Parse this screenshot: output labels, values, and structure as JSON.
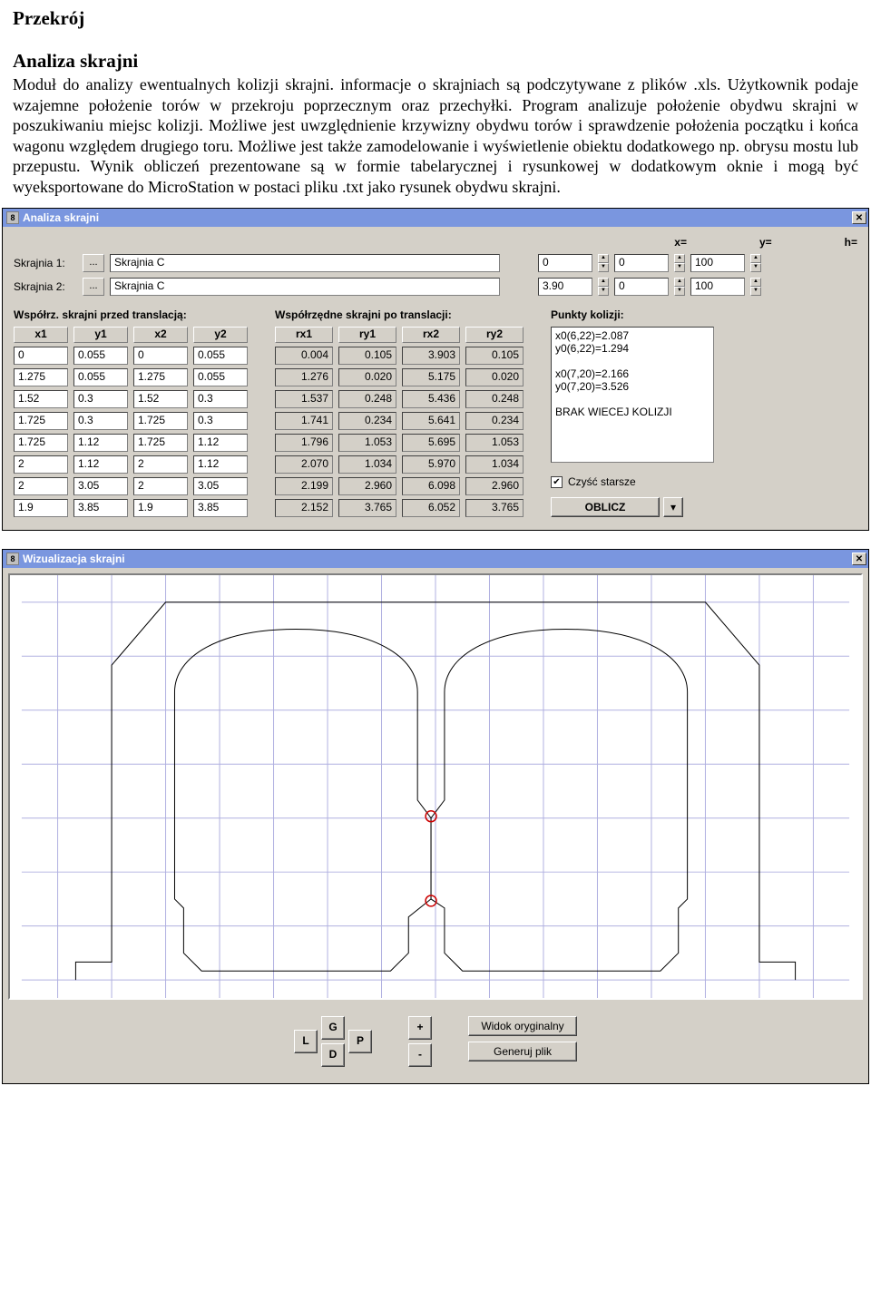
{
  "doc": {
    "heading": "Przekrój",
    "subheading": "Analiza skrajni",
    "paragraph": "Moduł do analizy ewentualnych kolizji skrajni. informacje o skrajniach są podczytywane z plików .xls. Użytkownik podaje wzajemne położenie torów w przekroju poprzecznym oraz przechyłki. Program analizuje położenie obydwu skrajni w poszukiwaniu miejsc kolizji. Możliwe jest uwzględnienie krzywizny obydwu torów i sprawdzenie położenia początku i końca wagonu względem drugiego toru. Możliwe jest także zamodelowanie i wyświetlenie obiektu dodatkowego np. obrysu mostu lub przepustu. Wynik obliczeń prezentowane są w formie tabelarycznej i rysunkowej w dodatkowym oknie i mogą być wyeksportowane do MicroStation w postaci pliku .txt jako rysunek obydwu skrajni."
  },
  "dlg1": {
    "title": "Analiza skrajni",
    "labels": {
      "skrajnia1": "Skrajnia 1:",
      "skrajnia2": "Skrajnia 2:",
      "browse": "...",
      "x": "x=",
      "y": "y=",
      "h": "h=",
      "sec_before": "Współrz. skrajni przed translacją:",
      "sec_after": "Współrzędne skrajni po translacji:",
      "sec_coll": "Punkty kolizji:",
      "x1": "x1",
      "y1": "y1",
      "x2": "x2",
      "y2": "y2",
      "rx1": "rx1",
      "ry1": "ry1",
      "rx2": "rx2",
      "ry2": "ry2",
      "czysc": "Czyść starsze",
      "oblicz": "OBLICZ"
    },
    "skrajnia1_val": "Skrajnia C",
    "skrajnia2_val": "Skrajnia C",
    "xyh1": {
      "x": "0",
      "y": "0",
      "h": "100"
    },
    "xyh2": {
      "x": "3.90",
      "y": "0",
      "h": "100"
    },
    "before": [
      [
        "0",
        "0.055",
        "0",
        "0.055"
      ],
      [
        "1.275",
        "0.055",
        "1.275",
        "0.055"
      ],
      [
        "1.52",
        "0.3",
        "1.52",
        "0.3"
      ],
      [
        "1.725",
        "0.3",
        "1.725",
        "0.3"
      ],
      [
        "1.725",
        "1.12",
        "1.725",
        "1.12"
      ],
      [
        "2",
        "1.12",
        "2",
        "1.12"
      ],
      [
        "2",
        "3.05",
        "2",
        "3.05"
      ],
      [
        "1.9",
        "3.85",
        "1.9",
        "3.85"
      ]
    ],
    "after": [
      [
        "0.004",
        "0.105",
        "3.903",
        "0.105"
      ],
      [
        "1.276",
        "0.020",
        "5.175",
        "0.020"
      ],
      [
        "1.537",
        "0.248",
        "5.436",
        "0.248"
      ],
      [
        "1.741",
        "0.234",
        "5.641",
        "0.234"
      ],
      [
        "1.796",
        "1.053",
        "5.695",
        "1.053"
      ],
      [
        "2.070",
        "1.034",
        "5.970",
        "1.034"
      ],
      [
        "2.199",
        "2.960",
        "6.098",
        "2.960"
      ],
      [
        "2.152",
        "3.765",
        "6.052",
        "3.765"
      ]
    ],
    "collisions": "x0(6,22)=2.087\ny0(6,22)=1.294\n\nx0(7,20)=2.166\ny0(7,20)=3.526\n\nBRAK WIECEJ KOLIZJI",
    "czysc_checked": true
  },
  "dlg2": {
    "title": "Wizualizacja skrajni",
    "btns": {
      "L": "L",
      "G": "G",
      "D": "D",
      "P": "P",
      "plus": "+",
      "minus": "-",
      "widok": "Widok oryginalny",
      "gen": "Generuj plik"
    }
  }
}
